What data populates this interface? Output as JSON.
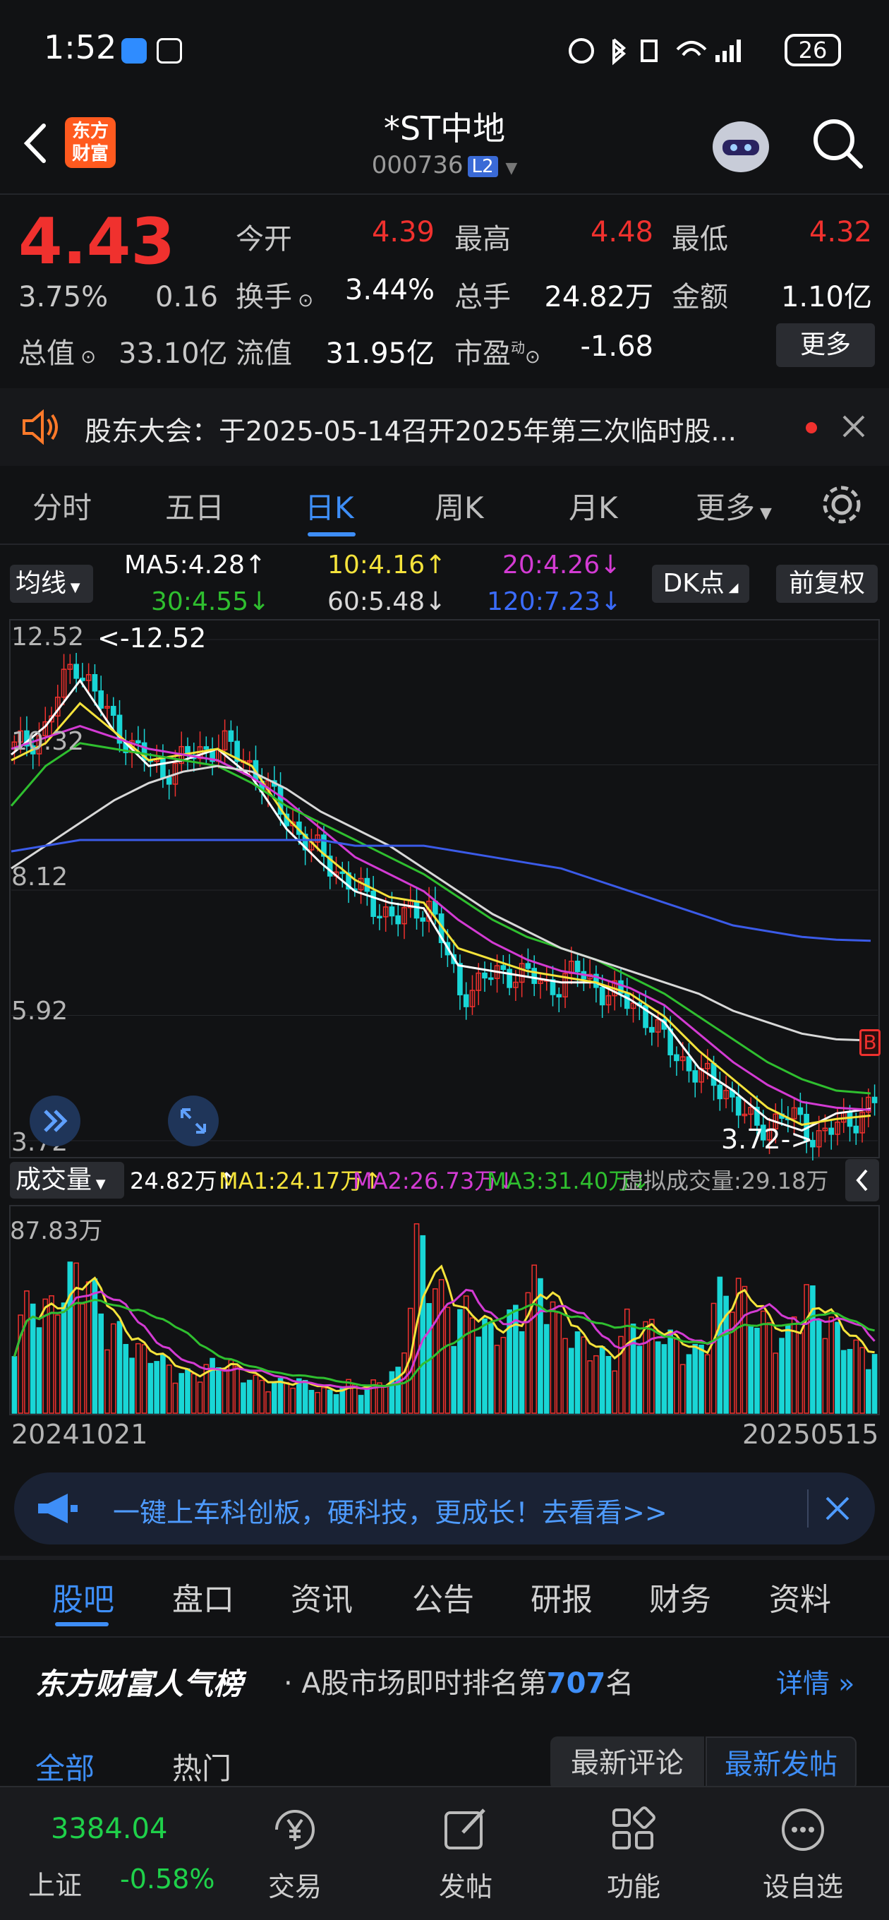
{
  "status_bar": {
    "time": "1:52",
    "battery": "26"
  },
  "header": {
    "title": "*ST中地",
    "code": "000736",
    "level_badge": "L2",
    "logo_text": "东方财富"
  },
  "quote": {
    "price": "4.43",
    "change_pct": "3.75%",
    "change_abs": "0.16",
    "open_label": "今开",
    "open": "4.39",
    "high_label": "最高",
    "high": "4.48",
    "low_label": "最低",
    "low": "4.32",
    "turnover_label": "换手",
    "turnover": "3.44%",
    "volume_label": "总手",
    "volume": "24.82万",
    "amount_label": "金额",
    "amount": "1.10亿",
    "mktcap_label": "总值",
    "mktcap": "33.10亿",
    "float_label": "流值",
    "float_cap": "31.95亿",
    "pe_label": "市盈",
    "pe_sup": "动",
    "pe": "-1.68",
    "more_label": "更多"
  },
  "notice": {
    "text": "股东大会：于2025-05-14召开2025年第三次临时股..."
  },
  "period_tabs": [
    "分时",
    "五日",
    "日K",
    "周K",
    "月K",
    "更多"
  ],
  "active_period": "日K",
  "legend": {
    "ma_button": "均线",
    "ma5": "MA5:4.28↑",
    "ma10": "10:4.16↑",
    "ma20": "20:4.26↓",
    "ma30": "30:4.55↓",
    "ma60": "60:5.48↓",
    "ma120": "120:7.23↓",
    "dk_button": "DK点",
    "adjust_button": "前复权",
    "colors": {
      "ma5": "#ffffff",
      "ma10": "#f5e33b",
      "ma20": "#d33bd3",
      "ma30": "#2fbf2f",
      "ma60": "#d8d8d8",
      "ma120": "#3b5be8"
    }
  },
  "price_axis": [
    "12.52",
    "10.32",
    "8.12",
    "5.92",
    "3.72"
  ],
  "annotations": {
    "high": "<-12.52",
    "low": "3.72->",
    "b_marker": "B"
  },
  "volume": {
    "button": "成交量",
    "value": "24.82万↑",
    "ma1": "MA1:24.17万↑",
    "ma2": "MA2:26.73万↓",
    "ma3": "MA3:31.40万↓",
    "virtual": "虚拟成交量:29.18万",
    "axis_top": "87.83万"
  },
  "date_range": {
    "start": "20241021",
    "end": "20250515"
  },
  "banner": {
    "text": "一键上车科创板，硬科技，更成长！去看看>>"
  },
  "bottom_tabs": [
    "股吧",
    "盘口",
    "资讯",
    "公告",
    "研报",
    "财务",
    "资料"
  ],
  "active_bottom_tab": "股吧",
  "rank": {
    "title": "东方财富人气榜",
    "prefix": "· A股市场即时排名第",
    "number": "707",
    "suffix": "名",
    "detail": "详情"
  },
  "sub_tabs": [
    "全部",
    "热门"
  ],
  "sort_tabs": [
    "最新评论",
    "最新发帖"
  ],
  "bottom_nav": {
    "index_value": "3384.04",
    "index_name": "上证",
    "index_change": "-0.58%",
    "items": [
      "交易",
      "发帖",
      "功能",
      "设自选"
    ]
  },
  "chart_data": {
    "type": "candlestick",
    "x_range": [
      "20241021",
      "20250515"
    ],
    "ylim": [
      3.72,
      12.52
    ],
    "y_ticks": [
      12.52,
      10.32,
      8.12,
      5.92,
      3.72
    ],
    "close_samples": [
      10.6,
      10.9,
      12.2,
      11.3,
      10.6,
      10.2,
      10.5,
      10.7,
      10.3,
      9.5,
      8.9,
      8.4,
      7.9,
      7.6,
      7.9,
      6.3,
      6.6,
      6.7,
      6.4,
      6.7,
      6.3,
      6.1,
      5.4,
      4.9,
      4.6,
      3.9,
      4.2,
      3.8,
      4.0,
      4.4
    ],
    "series": [
      {
        "name": "MA5",
        "values": [
          10.5,
          11.0,
          11.8,
          10.9,
          10.3,
          10.4,
          10.6,
          10.1,
          9.2,
          8.6,
          8.1,
          7.9,
          7.8,
          6.8,
          6.7,
          6.6,
          6.5,
          6.5,
          6.2,
          5.8,
          5.0,
          4.6,
          4.1,
          3.9,
          4.2,
          4.28
        ]
      },
      {
        "name": "MA10",
        "values": [
          10.4,
          10.7,
          11.4,
          10.9,
          10.4,
          10.5,
          10.6,
          10.3,
          9.4,
          8.8,
          8.3,
          8.0,
          7.9,
          7.1,
          6.9,
          6.7,
          6.6,
          6.5,
          6.3,
          5.9,
          5.3,
          4.8,
          4.3,
          4.0,
          4.1,
          4.16
        ]
      },
      {
        "name": "MA20",
        "values": [
          10.6,
          10.8,
          11.0,
          10.8,
          10.6,
          10.5,
          10.4,
          10.1,
          9.7,
          9.2,
          8.7,
          8.4,
          8.1,
          7.6,
          7.2,
          6.9,
          6.7,
          6.6,
          6.4,
          6.1,
          5.6,
          5.1,
          4.7,
          4.4,
          4.3,
          4.26
        ]
      },
      {
        "name": "MA30",
        "values": [
          9.6,
          10.3,
          10.7,
          10.6,
          10.5,
          10.4,
          10.3,
          10.0,
          9.6,
          9.3,
          9.0,
          8.7,
          8.4,
          8.0,
          7.6,
          7.3,
          7.1,
          6.9,
          6.6,
          6.3,
          5.9,
          5.5,
          5.1,
          4.8,
          4.6,
          4.55
        ]
      },
      {
        "name": "MA60",
        "values": [
          8.5,
          8.9,
          9.3,
          9.7,
          10.0,
          10.2,
          10.3,
          10.2,
          9.9,
          9.5,
          9.2,
          8.9,
          8.5,
          8.1,
          7.7,
          7.4,
          7.1,
          6.9,
          6.7,
          6.5,
          6.3,
          6.0,
          5.8,
          5.6,
          5.5,
          5.48
        ]
      },
      {
        "name": "MA120",
        "values": [
          8.8,
          8.9,
          9.0,
          9.0,
          9.0,
          9.0,
          9.0,
          9.0,
          9.0,
          9.0,
          8.9,
          8.9,
          8.9,
          8.8,
          8.7,
          8.6,
          8.5,
          8.3,
          8.1,
          7.9,
          7.7,
          7.5,
          7.4,
          7.3,
          7.25,
          7.23
        ]
      }
    ],
    "volume_max": "87.83万",
    "volume_samples": [
      40,
      55,
      48,
      62,
      70,
      45,
      38,
      30,
      28,
      20,
      18,
      22,
      25,
      18,
      15,
      14,
      16,
      12,
      10,
      14,
      12,
      16,
      20,
      85,
      60,
      45,
      50,
      38,
      40,
      55,
      65,
      42,
      35,
      30,
      25,
      45,
      40,
      38,
      30,
      28,
      55,
      62,
      48,
      40,
      35,
      60,
      45,
      38,
      30,
      28
    ]
  }
}
